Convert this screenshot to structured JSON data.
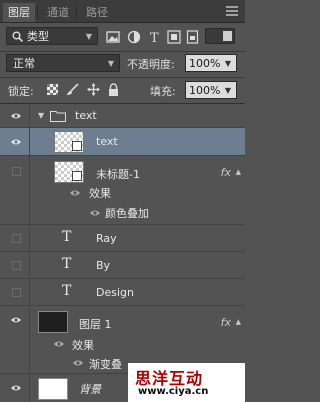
{
  "tabs": [
    {
      "label": "图层",
      "active": true
    },
    {
      "label": "通道",
      "active": false
    },
    {
      "label": "路径",
      "active": false
    }
  ],
  "filter": {
    "kind_label": "类型",
    "icons": [
      "image-filter-icon",
      "adjustment-filter-icon",
      "type-filter-icon",
      "shape-filter-icon",
      "smart-object-filter-icon"
    ]
  },
  "blend": {
    "mode": "正常",
    "opacity_label": "不透明度:",
    "opacity": "100%"
  },
  "lock": {
    "label": "锁定:",
    "icons": [
      "lock-transparent-icon",
      "lock-paint-icon",
      "lock-position-icon",
      "lock-all-icon"
    ],
    "fill_label": "填充:",
    "fill": "100%"
  },
  "layers": {
    "group": {
      "name": "text"
    },
    "text_layer": {
      "name": "text"
    },
    "untitled": {
      "name": "未标题-1",
      "fx": "fx",
      "effects_label": "效果",
      "effect_1": "颜色叠加"
    },
    "ray": {
      "name": "Ray",
      "glyph": "T"
    },
    "by": {
      "name": "By",
      "glyph": "T"
    },
    "design": {
      "name": "Design",
      "glyph": "T"
    },
    "layer1": {
      "name": "图层 1",
      "fx": "fx",
      "effects_label": "效果",
      "effect_1": "渐变叠"
    },
    "background": {
      "name": "背景"
    }
  },
  "watermark": {
    "line1": "思洋互动",
    "line2": "www.ciya.cn"
  },
  "colors": {
    "panel": "#535353",
    "selected": "#6e7e91",
    "watermark_red": "#b00000"
  }
}
